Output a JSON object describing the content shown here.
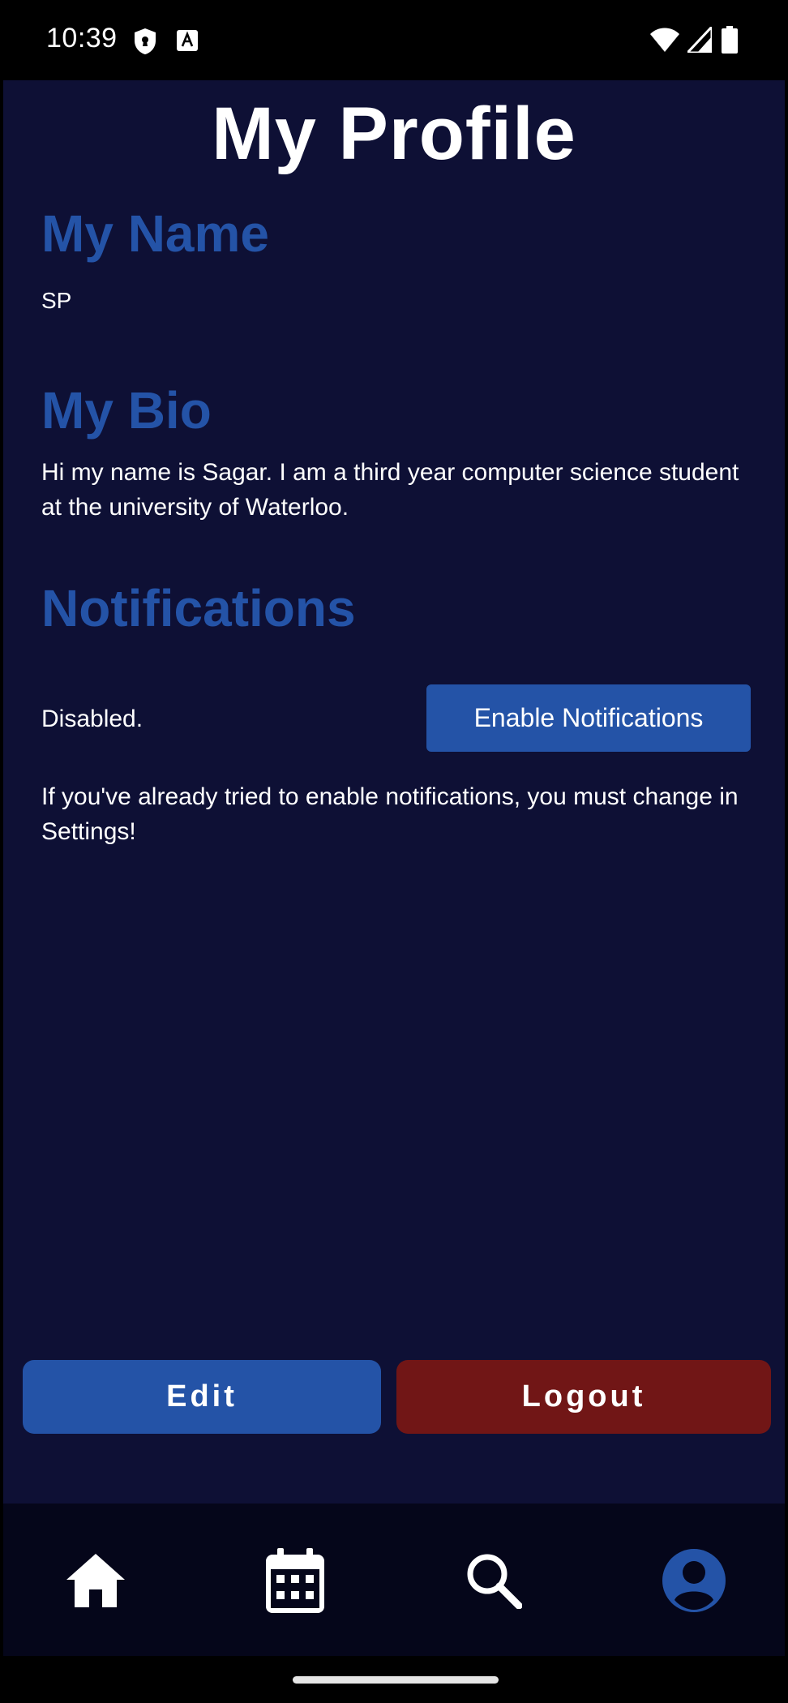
{
  "status_bar": {
    "time": "10:39",
    "icons": [
      "shield-icon",
      "a-font-icon",
      "wifi-icon",
      "signal-icon",
      "battery-icon"
    ]
  },
  "profile": {
    "title": "My Profile",
    "name_heading": "My Name",
    "name_value": "SP",
    "bio_heading": "My Bio",
    "bio_text": "Hi my name is Sagar. I am a third year computer science student at the university of Waterloo.",
    "notifications_heading": "Notifications",
    "notifications_status": "Disabled.",
    "enable_button_label": "Enable Notifications",
    "notifications_help": "If you've already tried to enable notifications, you must change in Settings!"
  },
  "actions": {
    "edit_label": "Edit",
    "logout_label": "Logout"
  },
  "bottom_nav": {
    "items": [
      {
        "icon": "home-icon",
        "active": false
      },
      {
        "icon": "calendar-icon",
        "active": false
      },
      {
        "icon": "search-icon",
        "active": false
      },
      {
        "icon": "profile-icon",
        "active": true
      }
    ]
  },
  "colors": {
    "background": "#0e1035",
    "accent_blue": "#2453a7",
    "logout_red": "#711616",
    "nav_background": "#05061a",
    "text": "#ffffff"
  }
}
